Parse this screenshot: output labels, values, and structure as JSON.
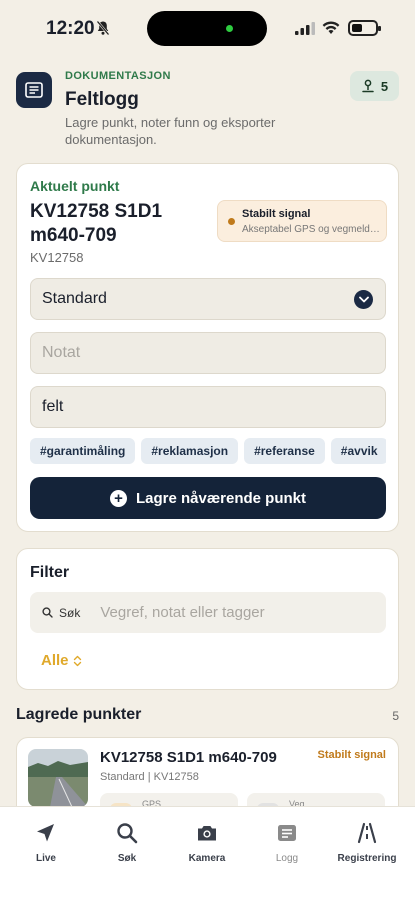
{
  "status_bar": {
    "time": "12:20",
    "battery_level": 0.45
  },
  "header": {
    "eyebrow": "DOKUMENTASJON",
    "title": "Feltlogg",
    "subtitle": "Lagre punkt, noter funn og eksporter dokumentasjon.",
    "count": "5"
  },
  "current_point": {
    "label": "Aktuelt punkt",
    "title": "KV12758 S1D1 m640-709",
    "subtitle": "KV12758",
    "signal_title": "Stabilt signal",
    "signal_desc": "Akseptabel GPS og vegmeldinger",
    "select_value": "Standard",
    "note_placeholder": "Notat",
    "tags_value": "felt",
    "chips": [
      "#garantimåling",
      "#reklamasjon",
      "#referanse",
      "#avvik"
    ],
    "save_label": "Lagre nåværende punkt"
  },
  "filter": {
    "title": "Filter",
    "search_label": "Søk",
    "search_placeholder": "Vegref, notat eller tagger",
    "scope": "Alle"
  },
  "saved": {
    "title": "Lagrede punkter",
    "count": "5",
    "items": [
      {
        "title": "KV12758 S1D1 m640-709",
        "subtitle": "Standard | KV12758",
        "status": "Stabilt signal",
        "meta1": "GPS",
        "meta2": "Veg"
      }
    ]
  },
  "tabs": [
    {
      "label": "Live",
      "icon": "location-arrow-icon"
    },
    {
      "label": "Søk",
      "icon": "search-icon"
    },
    {
      "label": "Kamera",
      "icon": "camera-icon"
    },
    {
      "label": "Logg",
      "icon": "list-icon"
    },
    {
      "label": "Registrering",
      "icon": "road-icon"
    }
  ],
  "colors": {
    "accent_green": "#2f7a4a",
    "navy": "#142339",
    "signal_amber": "#c07a1b",
    "filter_yellow": "#e0a92b"
  }
}
